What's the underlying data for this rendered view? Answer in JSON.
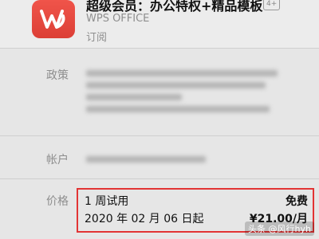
{
  "app": {
    "title": "超级会员：办公特权+精品模板",
    "age_rating": "4+",
    "developer": "WPS OFFICE",
    "type": "订阅",
    "icon": "wps-logo-icon",
    "brand_color": "#e5463e"
  },
  "rows": {
    "policy_label": "政策",
    "account_label": "帐户",
    "price_label": "价格"
  },
  "price": {
    "trial_label": "1 周试用",
    "trial_price": "免费",
    "start_date": "2020 年 02 月 06 日起",
    "recurring_price": "¥21.00/月",
    "highlight_color": "#e23434"
  },
  "watermark": "头条 @风行hyh"
}
